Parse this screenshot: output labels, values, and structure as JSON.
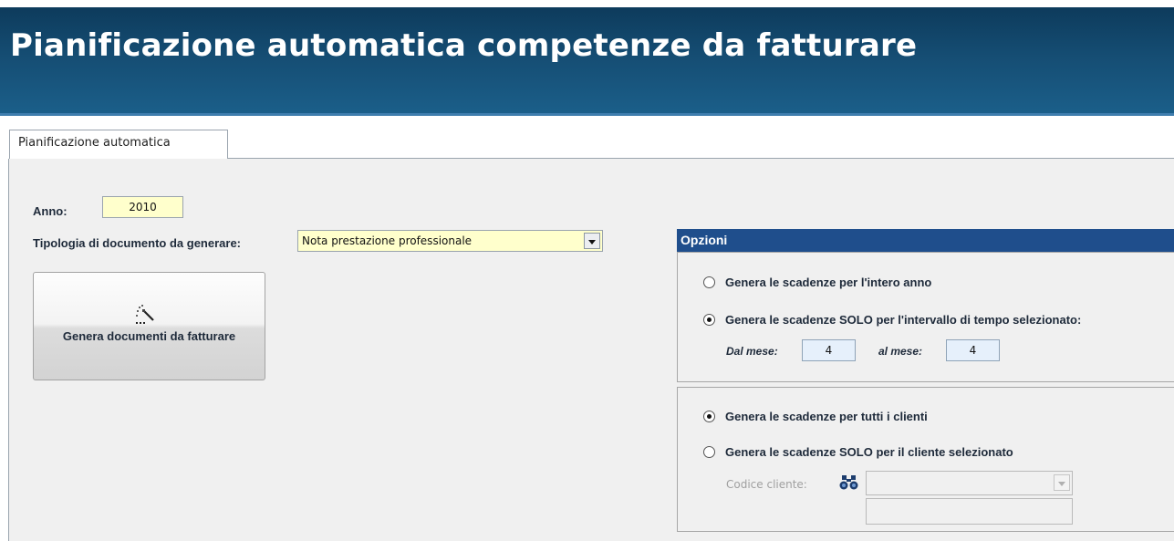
{
  "window": {
    "title": "Pianificazione automatica competenze da fatturare"
  },
  "tabs": [
    {
      "label": "Pianificazione automatica",
      "active": true
    }
  ],
  "form": {
    "anno_label": "Anno:",
    "anno_value": "2010",
    "tipologia_label": "Tipologia di documento da generare:",
    "tipologia_value": "Nota prestazione professionale",
    "generate_button_label": "Genera documenti da fatturare",
    "generate_button_icon": "wand-icon"
  },
  "opzioni": {
    "title": "Opzioni",
    "periodo": {
      "options": [
        {
          "label": "Genera le scadenze per l'intero anno",
          "checked": false
        },
        {
          "label": "Genera le scadenze SOLO per l'intervallo di tempo selezionato:",
          "checked": true
        }
      ],
      "dal_mese_label": "Dal mese:",
      "dal_mese_value": "4",
      "al_mese_label": "al mese:",
      "al_mese_value": "4"
    },
    "clienti": {
      "options": [
        {
          "label": "Genera le scadenze per tutti i clienti",
          "checked": true
        },
        {
          "label": "Genera le scadenze SOLO per il cliente selezionato",
          "checked": false
        }
      ],
      "codice_cliente_label": "Codice cliente:",
      "codice_cliente_value": "",
      "cliente_name_value": "",
      "search_icon": "binoculars-icon"
    }
  },
  "colors": {
    "header_bg": "#154d73",
    "options_header_bg": "#1f4e8c",
    "input_bg": "#ffffcc",
    "month_input_bg": "#e6f0fb"
  }
}
